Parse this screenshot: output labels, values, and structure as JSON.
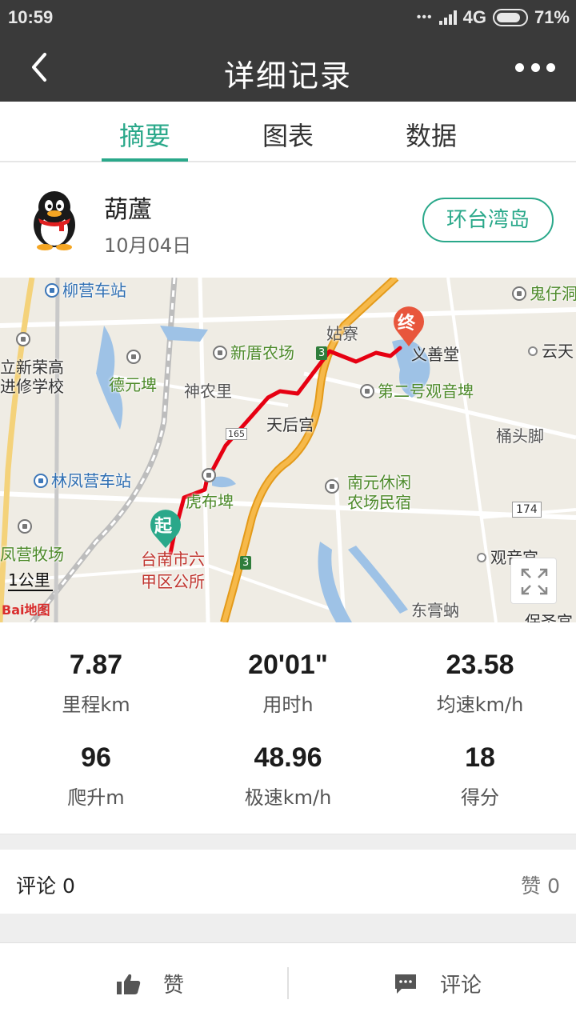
{
  "status_bar": {
    "time": "10:59",
    "network": "4G",
    "battery": "71%"
  },
  "header": {
    "title": "详细记录"
  },
  "tabs": [
    {
      "label": "摘要",
      "active": true
    },
    {
      "label": "图表",
      "active": false
    },
    {
      "label": "数据",
      "active": false
    }
  ],
  "user": {
    "name": "葫蘆",
    "date": "10月04日",
    "route_button": "环台湾岛"
  },
  "map": {
    "pois": {
      "p1": "柳营车站",
      "p2": "鬼仔洞",
      "p3": "姑寮",
      "p4": "义善堂",
      "p5": "新厝农场",
      "p6": "云天",
      "p7": "立新荣高",
      "p8": "进修学校",
      "p9": "德元埤",
      "p10": "神农里",
      "p11": "第二号观音埤",
      "p12": "天后宫",
      "p13": "桶头脚",
      "p14": "林凤营车站",
      "p15": "虎布埤",
      "p16": "南元休闲",
      "p17": "农场民宿",
      "p18": "凤营牧场",
      "p19": "台南市六",
      "p20": "甲区公所",
      "p21": "观音宫",
      "p22": "东膏蚋",
      "p23": "保圣宫"
    },
    "road_labels": {
      "r1": "3",
      "r2": "3",
      "r3": "165",
      "r4": "174"
    },
    "scale": "1公里",
    "logo": "Bai地图",
    "start_marker": "起",
    "end_marker": "终"
  },
  "stats": [
    {
      "value": "7.87",
      "label": "里程km"
    },
    {
      "value": "20'01\"",
      "label": "用时h"
    },
    {
      "value": "23.58",
      "label": "均速km/h"
    },
    {
      "value": "96",
      "label": "爬升m"
    },
    {
      "value": "48.96",
      "label": "极速km/h"
    },
    {
      "value": "18",
      "label": "得分"
    }
  ],
  "comments": {
    "label": "评论 0",
    "likes": "赞 0"
  },
  "actions": {
    "like": "赞",
    "comment": "评论"
  },
  "colors": {
    "accent": "#2aa88a",
    "route": "#e60012",
    "header": "#3a3a3a"
  }
}
